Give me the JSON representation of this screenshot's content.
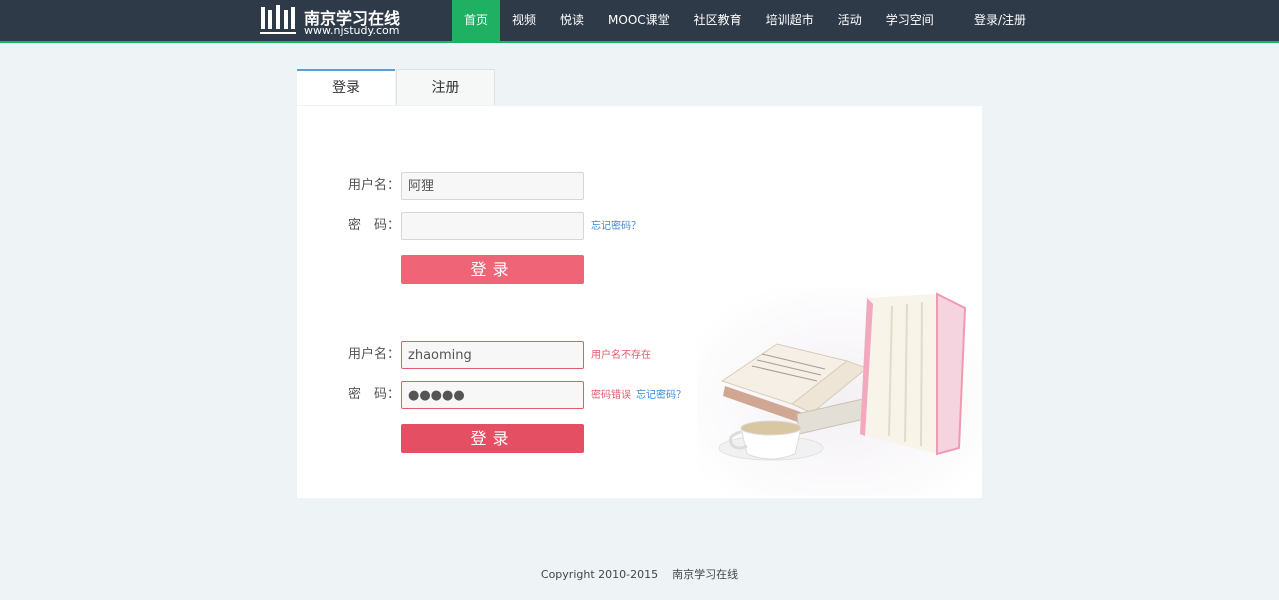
{
  "header": {
    "logo_title": "南京学习在线",
    "logo_url": "www.njstudy.com",
    "nav": [
      {
        "label": "首页",
        "active": true
      },
      {
        "label": "视频"
      },
      {
        "label": "悦读"
      },
      {
        "label": "MOOC课堂"
      },
      {
        "label": "社区教育"
      },
      {
        "label": "培训超市"
      },
      {
        "label": "活动"
      },
      {
        "label": "学习空间"
      }
    ],
    "login_register": "登录/注册",
    "accent_color": "#1fb164",
    "bg_color": "#2f3a48"
  },
  "tabs": {
    "login": "登录",
    "register": "注册"
  },
  "form_normal": {
    "username_label": "用户名：",
    "username_value": "阿狸",
    "password_label": "密　码：",
    "password_value": "",
    "forgot": "忘记密码？",
    "submit": "登录"
  },
  "form_error": {
    "username_label": "用户名：",
    "username_value": "zhaoming",
    "username_error": "用户名不存在",
    "password_label": "密　码：",
    "password_value": "●●●●●",
    "password_error": "密码错误",
    "forgot": "忘记密码？",
    "submit": "登录",
    "error_color": "#e65a6e"
  },
  "footer": {
    "copyright": "Copyright 2010-2015    南京学习在线"
  }
}
